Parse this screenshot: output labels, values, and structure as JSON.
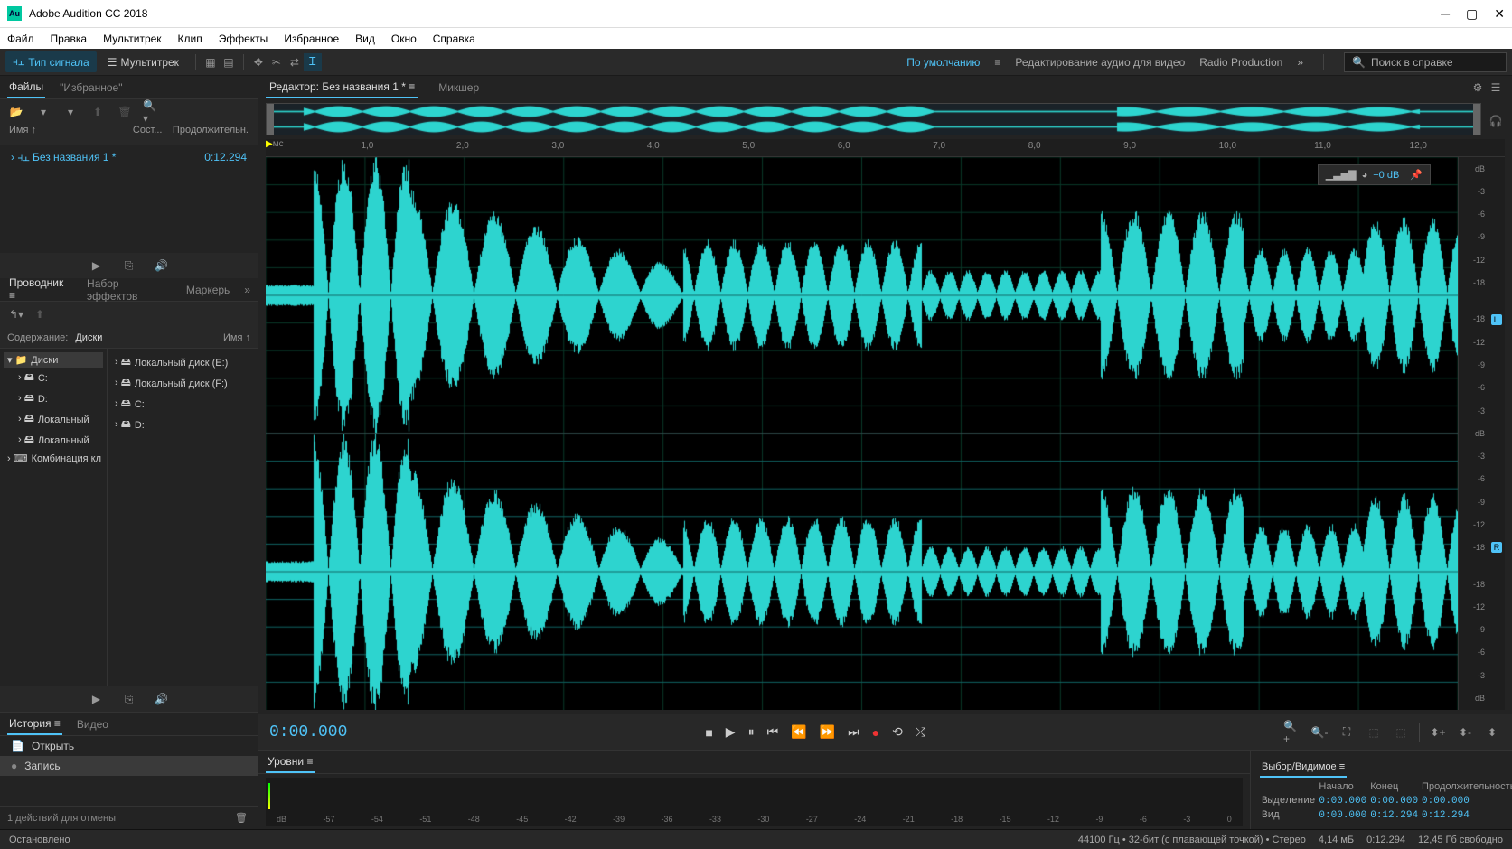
{
  "app": {
    "title": "Adobe Audition CC 2018",
    "logo": "Au"
  },
  "menu": [
    "Файл",
    "Правка",
    "Мультитрек",
    "Клип",
    "Эффекты",
    "Избранное",
    "Вид",
    "Окно",
    "Справка"
  ],
  "toolbar": {
    "waveform": "Тип сигнала",
    "multitrack": "Мультитрек",
    "workspaces": {
      "default": "По умолчанию",
      "edit": "Редактирование аудио для видео",
      "radio": "Radio Production"
    },
    "search_placeholder": "Поиск в справке"
  },
  "files": {
    "tab_files": "Файлы",
    "tab_fav": "\"Избранное\"",
    "col_name": "Имя",
    "col_state": "Сост...",
    "col_dur": "Продолжительн.",
    "items": [
      {
        "name": "Без названия 1 *",
        "duration": "0:12.294"
      }
    ]
  },
  "explorer": {
    "tab_explorer": "Проводник",
    "tab_effects": "Набор эффектов",
    "tab_markers": "Маркерь",
    "content_label": "Содержание:",
    "content_value": "Диски",
    "col_name": "Имя",
    "tree": [
      {
        "label": "Диски",
        "icon": "folder",
        "sel": true
      },
      {
        "label": "C:",
        "icon": "drive"
      },
      {
        "label": "D:",
        "icon": "drive"
      },
      {
        "label": "Локальный",
        "icon": "drive"
      },
      {
        "label": "Локальный",
        "icon": "drive"
      },
      {
        "label": "Комбинация кл",
        "icon": "kbd"
      }
    ],
    "list": [
      {
        "label": "Локальный диск (E:)",
        "icon": "drive"
      },
      {
        "label": "Локальный диск (F:)",
        "icon": "drive"
      },
      {
        "label": "C:",
        "icon": "drive"
      },
      {
        "label": "D:",
        "icon": "drive"
      }
    ]
  },
  "history": {
    "tab_history": "История",
    "tab_video": "Видео",
    "items": [
      {
        "label": "Открыть",
        "icon": "open"
      },
      {
        "label": "Запись",
        "icon": "record",
        "active": true
      }
    ],
    "undo_text": "1 действий для отмены"
  },
  "editor": {
    "tab_editor": "Редактор: Без названия 1 *",
    "tab_mixer": "Микшер",
    "ruler_unit": "мс",
    "ruler_ticks": [
      "1,0",
      "2,0",
      "3,0",
      "4,0",
      "5,0",
      "6,0",
      "7,0",
      "8,0",
      "9,0",
      "10,0",
      "11,0",
      "12,0"
    ],
    "db_labels": [
      "dB",
      "-3",
      "-6",
      "-9",
      "-12",
      "-18",
      "-",
      "-18",
      "-12",
      "-9",
      "-6",
      "-3",
      "dB"
    ],
    "hud_value": "+0 dB",
    "channel_L": "L",
    "channel_R": "R"
  },
  "transport": {
    "time": "0:00.000"
  },
  "levels": {
    "title": "Уровни",
    "scale": [
      "dB",
      "-57",
      "-54",
      "-51",
      "-48",
      "-45",
      "-42",
      "-39",
      "-36",
      "-33",
      "-30",
      "-27",
      "-24",
      "-21",
      "-18",
      "-15",
      "-12",
      "-9",
      "-6",
      "-3",
      "0"
    ]
  },
  "selection": {
    "title": "Выбор/Видимое",
    "col_start": "Начало",
    "col_end": "Конец",
    "col_dur": "Продолжительность",
    "row_sel": "Выделение",
    "row_view": "Вид",
    "sel": {
      "start": "0:00.000",
      "end": "0:00.000",
      "dur": "0:00.000"
    },
    "view": {
      "start": "0:00.000",
      "end": "0:12.294",
      "dur": "0:12.294"
    }
  },
  "status": {
    "left": "Остановлено",
    "format": "44100 Гц • 32-бит (с плавающей точкой) • Стерео",
    "size": "4,14 мБ",
    "dur": "0:12.294",
    "free": "12,45 Гб свободно"
  }
}
